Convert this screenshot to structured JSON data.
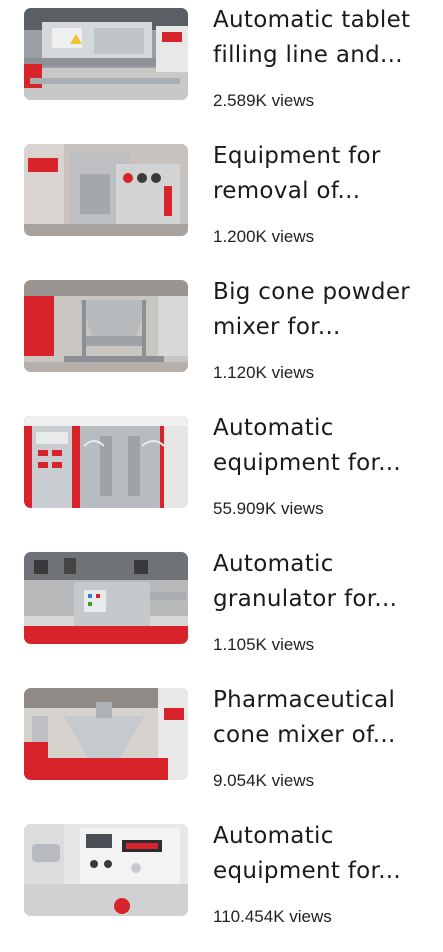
{
  "videos": [
    {
      "title": "Automatic tablet filling line and...",
      "views": "2.589K views"
    },
    {
      "title": "Equipment for removal of...",
      "views": "1.200K views"
    },
    {
      "title": "Big cone powder mixer for...",
      "views": "1.120K views"
    },
    {
      "title": "Automatic equipment for...",
      "views": "55.909K views"
    },
    {
      "title": "Automatic granulator for...",
      "views": "1.105K views"
    },
    {
      "title": "Pharmaceutical cone mixer of...",
      "views": "9.054K views"
    },
    {
      "title": "Automatic equipment for...",
      "views": "110.454K views"
    }
  ],
  "colors": {
    "text": "#1a1a1a",
    "exhibition_red": "#d8232a",
    "steel": "#b8bcc0"
  }
}
